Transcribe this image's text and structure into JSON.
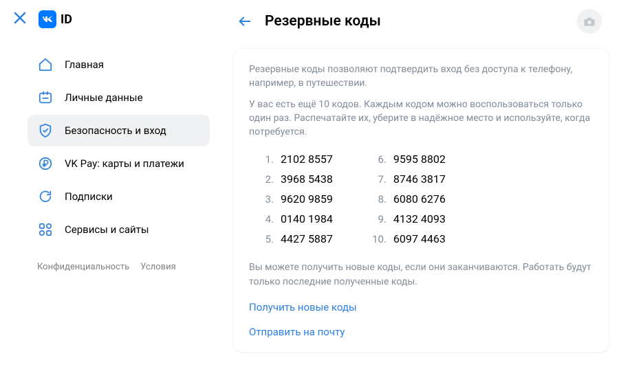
{
  "header": {
    "id_label": "ID",
    "page_title": "Резервные коды"
  },
  "sidebar": {
    "items": [
      {
        "label": "Главная"
      },
      {
        "label": "Личные данные"
      },
      {
        "label": "Безопасность и вход"
      },
      {
        "label": "VK Pay: карты и платежи"
      },
      {
        "label": "Подписки"
      },
      {
        "label": "Сервисы и сайты"
      }
    ],
    "footer": {
      "privacy": "Конфиденциальность",
      "terms": "Условия"
    }
  },
  "content": {
    "desc1": "Резервные коды позволяют подтвердить вход без доступа к телефону, например, в путешествии.",
    "desc2": "У вас есть ещё 10 кодов. Каждым кодом можно воспользоваться только один раз. Распечатайте их, уберите в надёжное место и используйте, когда потребуется.",
    "codes": [
      "2102 8557",
      "3968 5438",
      "9620 9859",
      "0140 1984",
      "4427 5887",
      "9595 8802",
      "8746 3817",
      "6080 6276",
      "4132 4093",
      "6097 4463"
    ],
    "desc3": "Вы можете получить новые коды, если они заканчиваются. Работать будут только последние полученные коды.",
    "action_new": "Получить новые коды",
    "action_email": "Отправить на почту"
  }
}
